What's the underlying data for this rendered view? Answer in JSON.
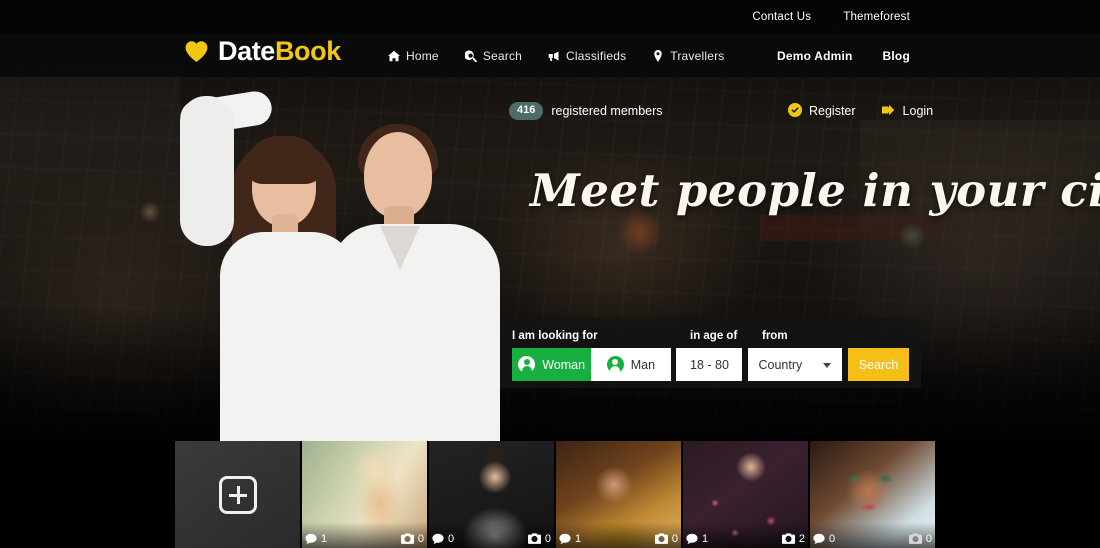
{
  "topbar": {
    "links": [
      {
        "label": "Contact Us",
        "name": "contact-us-link"
      },
      {
        "label": "Themeforest",
        "name": "themeforest-link"
      }
    ]
  },
  "brand": {
    "name_part1": "Date",
    "name_part2": "Book",
    "heart_color": "#f2c713"
  },
  "nav": {
    "main": [
      {
        "label": "Home",
        "icon": "home-icon"
      },
      {
        "label": "Search",
        "icon": "search-icon"
      },
      {
        "label": "Classifieds",
        "icon": "bullhorn-icon"
      },
      {
        "label": "Travellers",
        "icon": "map-pin-icon"
      }
    ],
    "right": [
      {
        "label": "Demo Admin"
      },
      {
        "label": "Blog"
      }
    ]
  },
  "members": {
    "count": "416",
    "label": "registered members",
    "badge_color": "#4c6b6a"
  },
  "auth": {
    "register": "Register",
    "register_icon": "check-circle-icon",
    "login": "Login",
    "login_icon": "sign-in-icon"
  },
  "hero": {
    "headline": "Meet people in your city!"
  },
  "search_form": {
    "label_looking": "I am looking for",
    "label_age": "in age of",
    "label_from": "from",
    "gender_options": [
      {
        "label": "Woman",
        "selected": true
      },
      {
        "label": "Man",
        "selected": false
      }
    ],
    "age_value": "18 - 80",
    "age_placeholder": "18 - 80",
    "country_value": "Country",
    "country_options": [
      "Country"
    ],
    "submit_label": "Search",
    "accent_active": "#17af3f",
    "accent_submit": "#f5bf18"
  },
  "thumbnails": [
    {
      "kind": "add",
      "icon": "plus-square-icon",
      "comments": null,
      "photos": null
    },
    {
      "kind": "photo",
      "comments": "1",
      "photos": "0",
      "tone": "blonde-field"
    },
    {
      "kind": "photo",
      "comments": "0",
      "photos": "0",
      "tone": "man-hoodie"
    },
    {
      "kind": "photo",
      "comments": "1",
      "photos": "0",
      "tone": "woman-gold"
    },
    {
      "kind": "photo",
      "comments": "1",
      "photos": "2",
      "tone": "woman-floral"
    },
    {
      "kind": "photo",
      "comments": "0",
      "photos": "0",
      "tone": "woman-sunglasses"
    }
  ]
}
